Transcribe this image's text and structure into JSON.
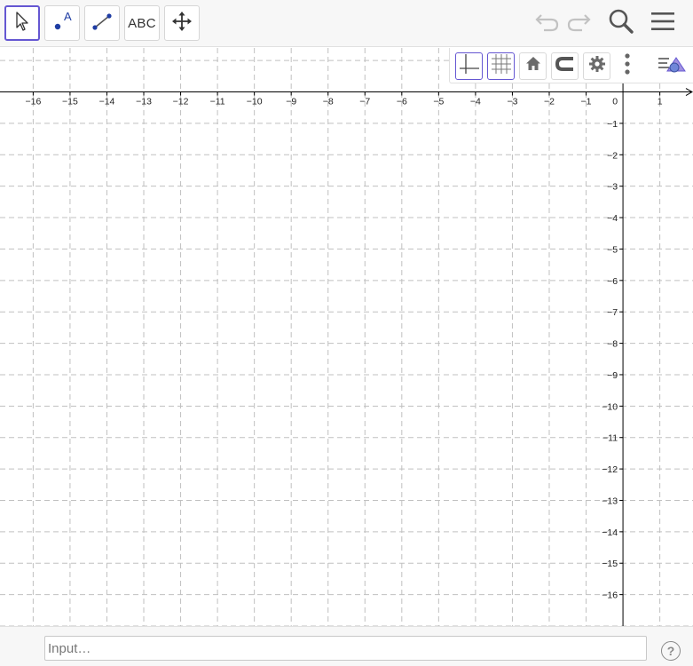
{
  "toolbar": {
    "tools": [
      {
        "name": "Move",
        "icon": "pointer-arrow-icon",
        "selected": true
      },
      {
        "name": "Point",
        "icon": "point-icon",
        "label": "A"
      },
      {
        "name": "Segment",
        "icon": "segment-icon"
      },
      {
        "name": "Text",
        "icon": "text-tool",
        "label": "ABC"
      },
      {
        "name": "Move Graphics View",
        "icon": "move-arrows-icon"
      }
    ],
    "right_icons": [
      "undo-icon",
      "redo-icon",
      "search-icon",
      "menu-icon"
    ]
  },
  "stylebar": {
    "buttons": [
      "axes-toggle-icon",
      "grid-toggle-icon",
      "home-icon",
      "magnet-icon",
      "gear-icon",
      "more-vertical-icon",
      "algebra-view-toggle-icon"
    ]
  },
  "graph": {
    "x_ticks": [
      "−16",
      "−15",
      "−14",
      "−13",
      "−12",
      "−11",
      "−10",
      "−9",
      "−8",
      "−7",
      "−6",
      "−5",
      "−4",
      "−3",
      "−2",
      "−1",
      "0",
      "1"
    ],
    "y_ticks": [
      "−1",
      "−2",
      "−3",
      "−4",
      "−5",
      "−6",
      "−7",
      "−8",
      "−9",
      "−10",
      "−11",
      "−12",
      "−13",
      "−14",
      "−15",
      "−16"
    ],
    "x_range": [
      -16.9,
      1.9
    ],
    "y_range": [
      -17.0,
      1.4
    ],
    "grid": true,
    "colors": {
      "grid": "#c0c0c0",
      "axis": "#000000",
      "accent": "#6557d2"
    }
  },
  "inputbar": {
    "placeholder": "Input…",
    "help_label": "?"
  }
}
